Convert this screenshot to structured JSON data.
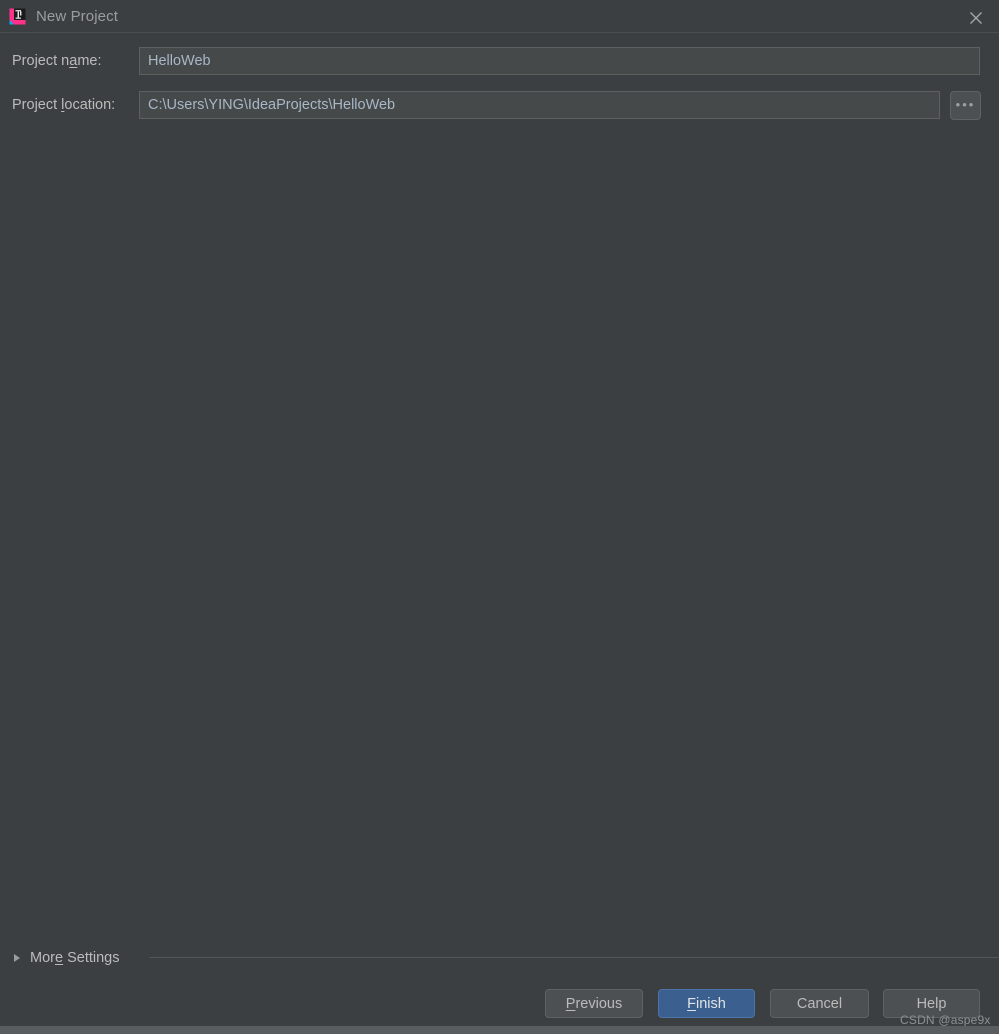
{
  "window": {
    "title": "New Project",
    "icon": "intellij-idea-icon",
    "close_label": "×",
    "background_color": "#3c3f41"
  },
  "form": {
    "fields": [
      {
        "label_before": "Project n",
        "label_mnemonic": "a",
        "label_after": "me:",
        "value": "HelloWeb",
        "placeholder": ""
      },
      {
        "label_before": "Project ",
        "label_mnemonic": "l",
        "label_after": "ocation:",
        "value": "C:\\Users\\YING\\IdeaProjects\\HelloWeb",
        "placeholder": ""
      }
    ],
    "browse_button": {
      "label": "•••",
      "name": "browse-ellipsis"
    }
  },
  "more_settings": {
    "label_before": "Mor",
    "label_mnemonic": "e",
    "label_after": " Settings",
    "expanded": false
  },
  "footer": {
    "buttons": [
      {
        "text_before": "",
        "mnemonic": "P",
        "text_after": "revious",
        "primary": false,
        "name": "previous-button"
      },
      {
        "text_before": "",
        "mnemonic": "F",
        "text_after": "inish",
        "primary": true,
        "name": "finish-button"
      },
      {
        "text_before": "Cancel",
        "mnemonic": "",
        "text_after": "",
        "primary": false,
        "name": "cancel-button"
      },
      {
        "text_before": "Help",
        "mnemonic": "",
        "text_after": "",
        "primary": false,
        "name": "help-button"
      }
    ]
  },
  "watermark": {
    "text": "CSDN @aspe9x"
  },
  "bottom_clip": {
    "text": " "
  },
  "colors": {
    "accent": "#3b6090",
    "field_background": "#45494a",
    "field_text": "#a9b7c6",
    "label_text": "#bbbbbb",
    "dialog_background": "#3c3f41"
  }
}
